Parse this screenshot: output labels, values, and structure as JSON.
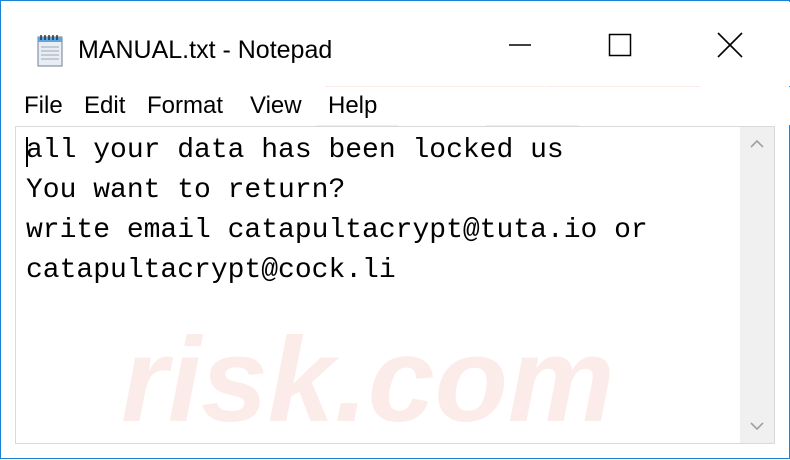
{
  "window": {
    "title": "MANUAL.txt - Notepad"
  },
  "menu": {
    "items": [
      "File",
      "Edit",
      "Format",
      "View",
      "Help"
    ]
  },
  "document": {
    "lines": [
      "all your data has been locked us",
      "You want to return?",
      "write email catapultacrypt@tuta.io or",
      "catapultacrypt@cock.li"
    ]
  },
  "icons": {
    "app": "notepad-icon",
    "minimize": "minimize-icon",
    "maximize": "maximize-icon",
    "close": "close-icon",
    "scroll_up": "chevron-up-icon",
    "scroll_down": "chevron-down-icon"
  },
  "colors": {
    "window_border": "#1883d7",
    "text": "#000000",
    "scrollbar_bg": "#f0f0f0",
    "watermark": "#f7ddd8"
  }
}
